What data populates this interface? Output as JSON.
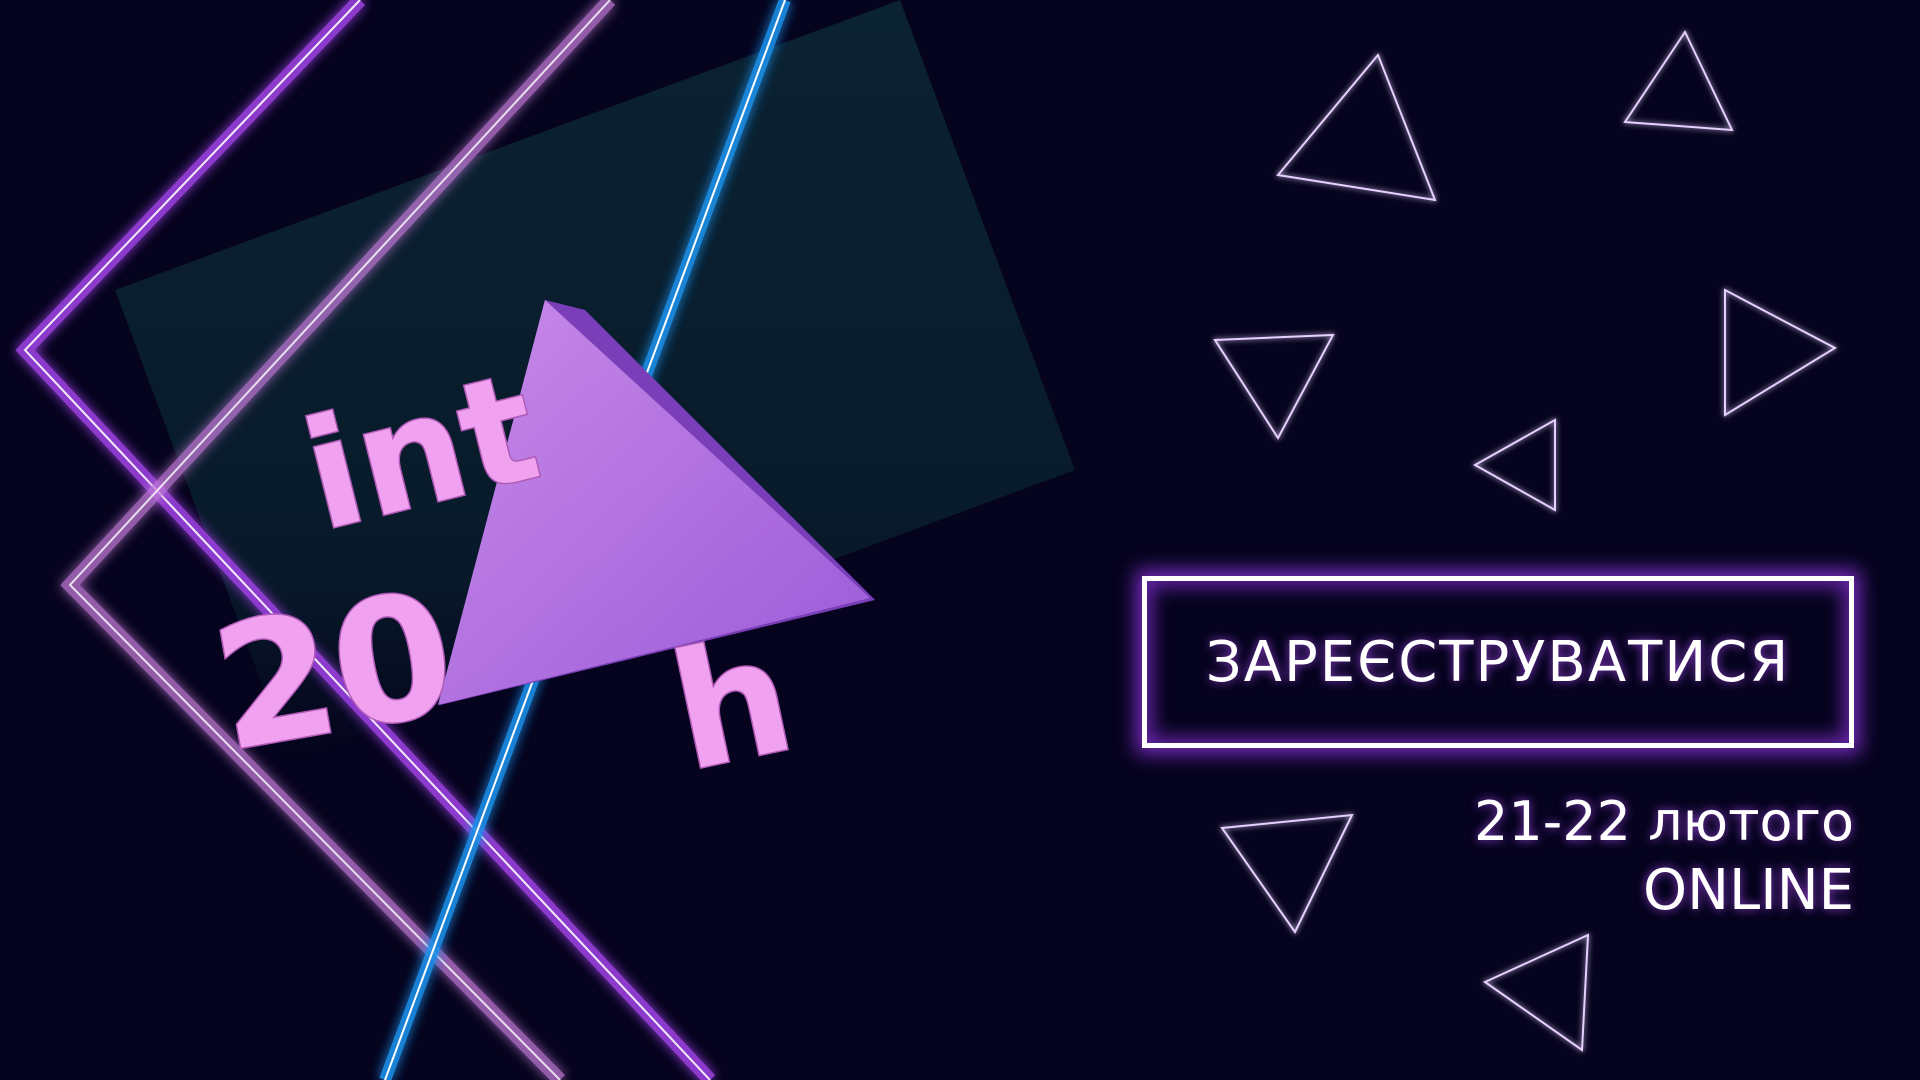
{
  "brand": {
    "logo_top": "int",
    "logo_num": "20",
    "logo_end": "h"
  },
  "cta": {
    "register_label": "ЗАРЕЄСТРУВАТИСЯ"
  },
  "event": {
    "dates": "21-22 лютого",
    "mode": "ONLINE"
  },
  "colors": {
    "background": "#05031d",
    "panel": "#0a1a2a",
    "neon_purple": "#9b3fe0",
    "neon_pink": "#c27ad8",
    "neon_blue": "#1f8fe8",
    "accent_triangle": "#b77ae8",
    "logo_pink": "#f0a2f0"
  }
}
